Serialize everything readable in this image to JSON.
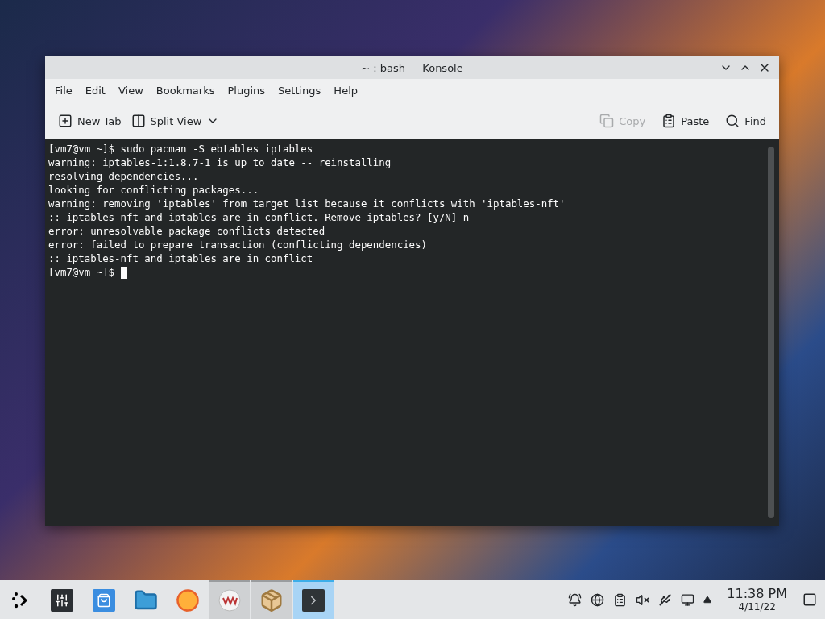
{
  "window": {
    "title": "~ : bash — Konsole"
  },
  "menu": [
    "File",
    "Edit",
    "View",
    "Bookmarks",
    "Plugins",
    "Settings",
    "Help"
  ],
  "toolbar_left": [
    {
      "kind": "newtab",
      "label": "New Tab",
      "disabled": false
    },
    {
      "kind": "split",
      "label": "Split View",
      "disabled": false
    }
  ],
  "toolbar_right": [
    {
      "kind": "copy",
      "label": "Copy",
      "disabled": true
    },
    {
      "kind": "paste",
      "label": "Paste",
      "disabled": false
    },
    {
      "kind": "find",
      "label": "Find",
      "disabled": false
    }
  ],
  "terminal": {
    "lines": [
      "[vm7@vm ~]$ sudo pacman -S ebtables iptables",
      "warning: iptables-1:1.8.7-1 is up to date -- reinstalling",
      "resolving dependencies...",
      "looking for conflicting packages...",
      "warning: removing 'iptables' from target list because it conflicts with 'iptables-nft'",
      ":: iptables-nft and iptables are in conflict. Remove iptables? [y/N] n",
      "error: unresolvable package conflicts detected",
      "error: failed to prepare transaction (conflicting dependencies)",
      ":: iptables-nft and iptables are in conflict",
      "[vm7@vm ~]$ "
    ]
  },
  "taskbar": {
    "tasks": [
      {
        "kind": "launcher",
        "open": false,
        "selected": false
      },
      {
        "kind": "settings",
        "open": false,
        "selected": false
      },
      {
        "kind": "store",
        "open": false,
        "selected": false
      },
      {
        "kind": "files",
        "open": false,
        "selected": false
      },
      {
        "kind": "browser",
        "open": false,
        "selected": false
      },
      {
        "kind": "vm",
        "open": true,
        "selected": false
      },
      {
        "kind": "package",
        "open": true,
        "selected": false
      },
      {
        "kind": "terminal",
        "open": true,
        "selected": true
      }
    ],
    "time": "11:38 PM",
    "date": "4/11/22"
  }
}
